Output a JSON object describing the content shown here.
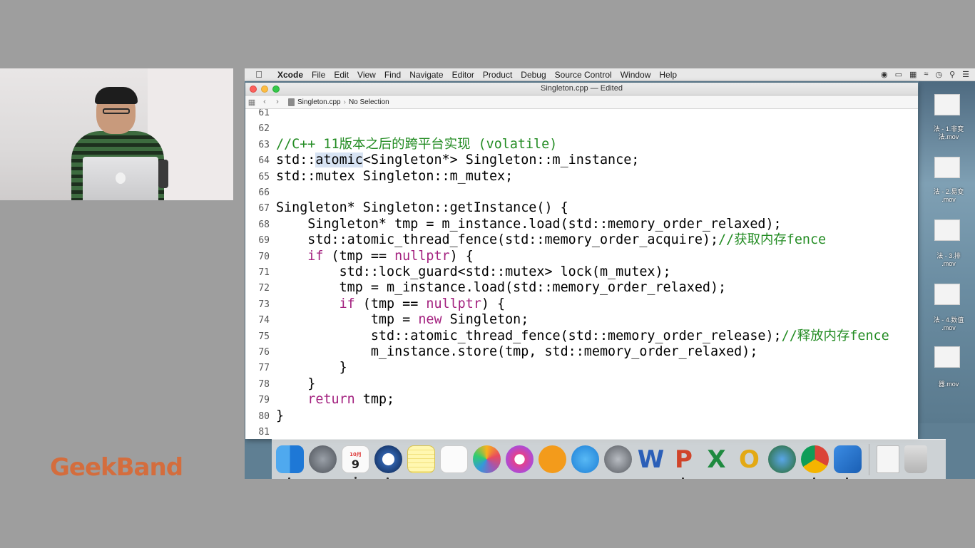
{
  "brand": "GeekBand",
  "menubar": {
    "items": [
      "Xcode",
      "File",
      "Edit",
      "View",
      "Find",
      "Navigate",
      "Editor",
      "Product",
      "Debug",
      "Source Control",
      "Window",
      "Help"
    ]
  },
  "window": {
    "title": "Singleton.cpp — Edited",
    "jumpbar": {
      "file": "Singleton.cpp",
      "selection": "No Selection"
    }
  },
  "editor": {
    "lines": [
      {
        "n": "61",
        "code": ""
      },
      {
        "n": "62",
        "code": ""
      },
      {
        "n": "63",
        "code": "//C++ 11版本之后的跨平台实现 (volatile)"
      },
      {
        "n": "64",
        "code": "std::atomic<Singleton*> Singleton::m_instance;"
      },
      {
        "n": "65",
        "code": "std::mutex Singleton::m_mutex;"
      },
      {
        "n": "66",
        "code": ""
      },
      {
        "n": "67",
        "code": "Singleton* Singleton::getInstance() {"
      },
      {
        "n": "68",
        "code": "    Singleton* tmp = m_instance.load(std::memory_order_relaxed);"
      },
      {
        "n": "69",
        "code": "    std::atomic_thread_fence(std::memory_order_acquire);//获取内存fence"
      },
      {
        "n": "70",
        "code": "    if (tmp == nullptr) {"
      },
      {
        "n": "71",
        "code": "        std::lock_guard<std::mutex> lock(m_mutex);"
      },
      {
        "n": "72",
        "code": "        tmp = m_instance.load(std::memory_order_relaxed);"
      },
      {
        "n": "73",
        "code": "        if (tmp == nullptr) {"
      },
      {
        "n": "74",
        "code": "            tmp = new Singleton;"
      },
      {
        "n": "75",
        "code": "            std::atomic_thread_fence(std::memory_order_release);//释放内存fence"
      },
      {
        "n": "76",
        "code": "            m_instance.store(tmp, std::memory_order_relaxed);"
      },
      {
        "n": "77",
        "code": "        }"
      },
      {
        "n": "78",
        "code": "    }"
      },
      {
        "n": "79",
        "code": "    return tmp;"
      },
      {
        "n": "80",
        "code": "}"
      },
      {
        "n": "81",
        "code": ""
      }
    ]
  },
  "desktop": {
    "labels": [
      "法 - 1.非变\n法.mov",
      "法 - 2.易变\n.mov",
      "法 - 3.排\n.mov",
      "法 - 4.数值\n.mov",
      "器.mov"
    ]
  },
  "dock": {
    "calendar_month": "10月",
    "calendar_day": "9"
  },
  "colors": {
    "comment": "#238c23",
    "keyword": "#a3217f",
    "brand": "#d46d3d"
  }
}
